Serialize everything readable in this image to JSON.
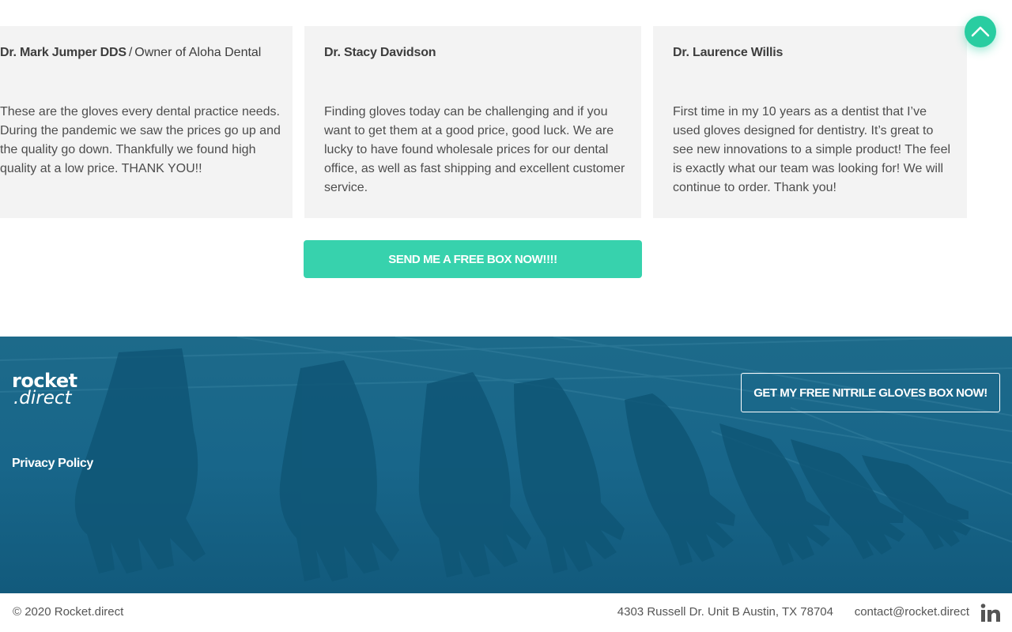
{
  "testimonials": [
    {
      "name": "Dr. Mark Jumper DDS",
      "separator": "/",
      "role": "Owner of Aloha Dental",
      "text": "These are the gloves every dental practice needs. During the pandemic we saw the prices go up and the quality go down. Thankfully we found high quality at a low price. THANK YOU!!"
    },
    {
      "name": "Dr. Stacy Davidson",
      "text": "Finding gloves today can be challenging and if you want to get them at a good price, good luck. We are lucky to have found wholesale prices for our dental office, as well as fast shipping and excellent customer service."
    },
    {
      "name": "Dr. Laurence Willis",
      "text": "First time in my 10 years as a dentist that I’ve used gloves designed for dentistry. It’s great to see new innovations to a simple product! The feel is exactly what our team was looking for! We will continue to order. Thank you!"
    }
  ],
  "cta": {
    "main_label": "SEND ME A FREE BOX NOW!!!!",
    "footer_label": "GET MY FREE NITRILE GLOVES BOX NOW!"
  },
  "footer": {
    "logo_top": "rocket",
    "logo_bottom": ".direct",
    "privacy_label": "Privacy Policy"
  },
  "bottom_bar": {
    "copyright": "© 2020 Rocket.direct",
    "address": "4303 Russell Dr. Unit B Austin, TX 78704",
    "email": "contact@rocket.direct",
    "social_icon": "linkedin-icon"
  },
  "icons": {
    "scroll_top": "chevron-up-icon"
  },
  "colors": {
    "accent": "#37d2ad",
    "footer_bg": "#18668a",
    "card_bg": "#f3f3f3"
  }
}
